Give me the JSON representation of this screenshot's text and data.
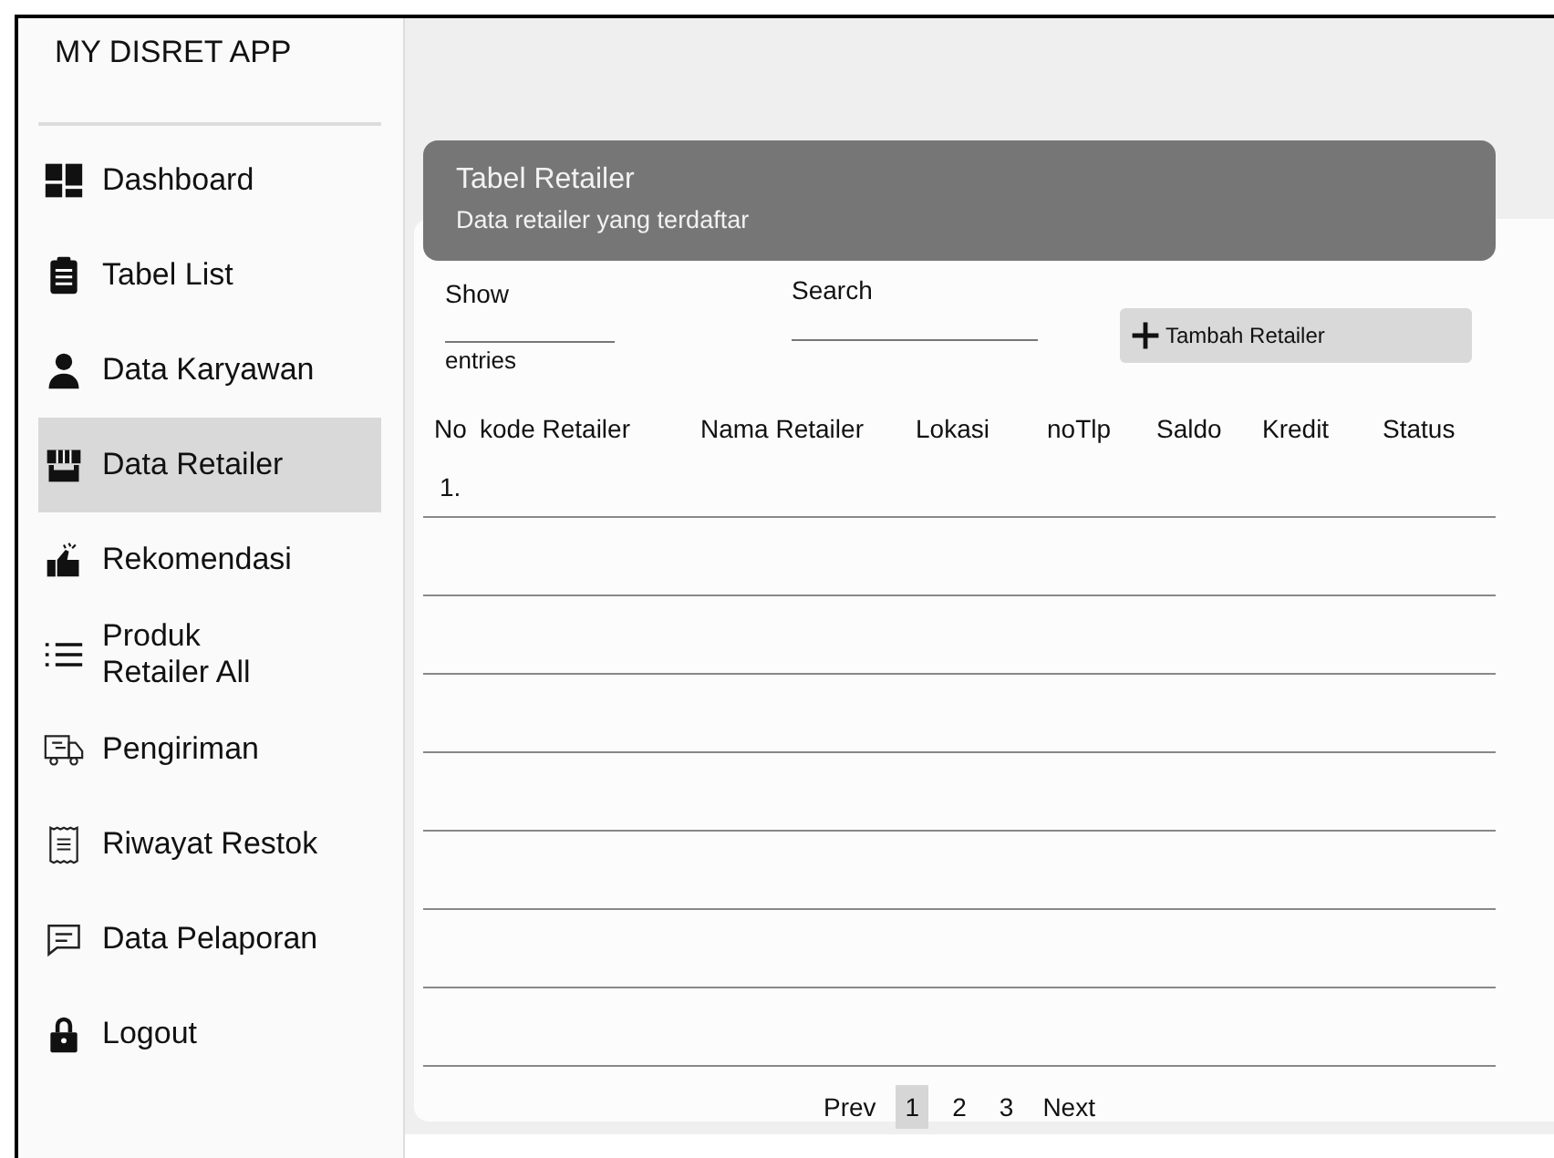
{
  "app_title": "MY DISRET APP",
  "sidebar": {
    "items": [
      {
        "label": "Dashboard",
        "selected": false
      },
      {
        "label": "Tabel List",
        "selected": false
      },
      {
        "label": "Data Karyawan",
        "selected": false
      },
      {
        "label": "Data Retailer",
        "selected": true
      },
      {
        "label": "Rekomendasi",
        "selected": false
      },
      {
        "label": "Produk\nRetailer All",
        "selected": false
      },
      {
        "label": "Pengiriman",
        "selected": false
      },
      {
        "label": "Riwayat Restok",
        "selected": false
      },
      {
        "label": "Data Pelaporan",
        "selected": false
      },
      {
        "label": "Logout",
        "selected": false
      }
    ]
  },
  "header": {
    "title": "Tabel Retailer",
    "subtitle": "Data retailer yang terdaftar"
  },
  "controls": {
    "show_label": "Show",
    "entries_label": "entries",
    "search_label": "Search",
    "add_button": "Tambah Retailer"
  },
  "table": {
    "columns": [
      "No",
      "kode Retailer",
      "Nama Retailer",
      "Lokasi",
      "noTlp",
      "Saldo",
      "Kredit",
      "Status"
    ],
    "rows": [
      {
        "no": "1."
      }
    ]
  },
  "pagination": {
    "prev": "Prev",
    "pages": [
      {
        "label": "1",
        "selected": true
      },
      {
        "label": "2",
        "selected": false
      },
      {
        "label": "3",
        "selected": false
      }
    ],
    "next": "Next"
  }
}
